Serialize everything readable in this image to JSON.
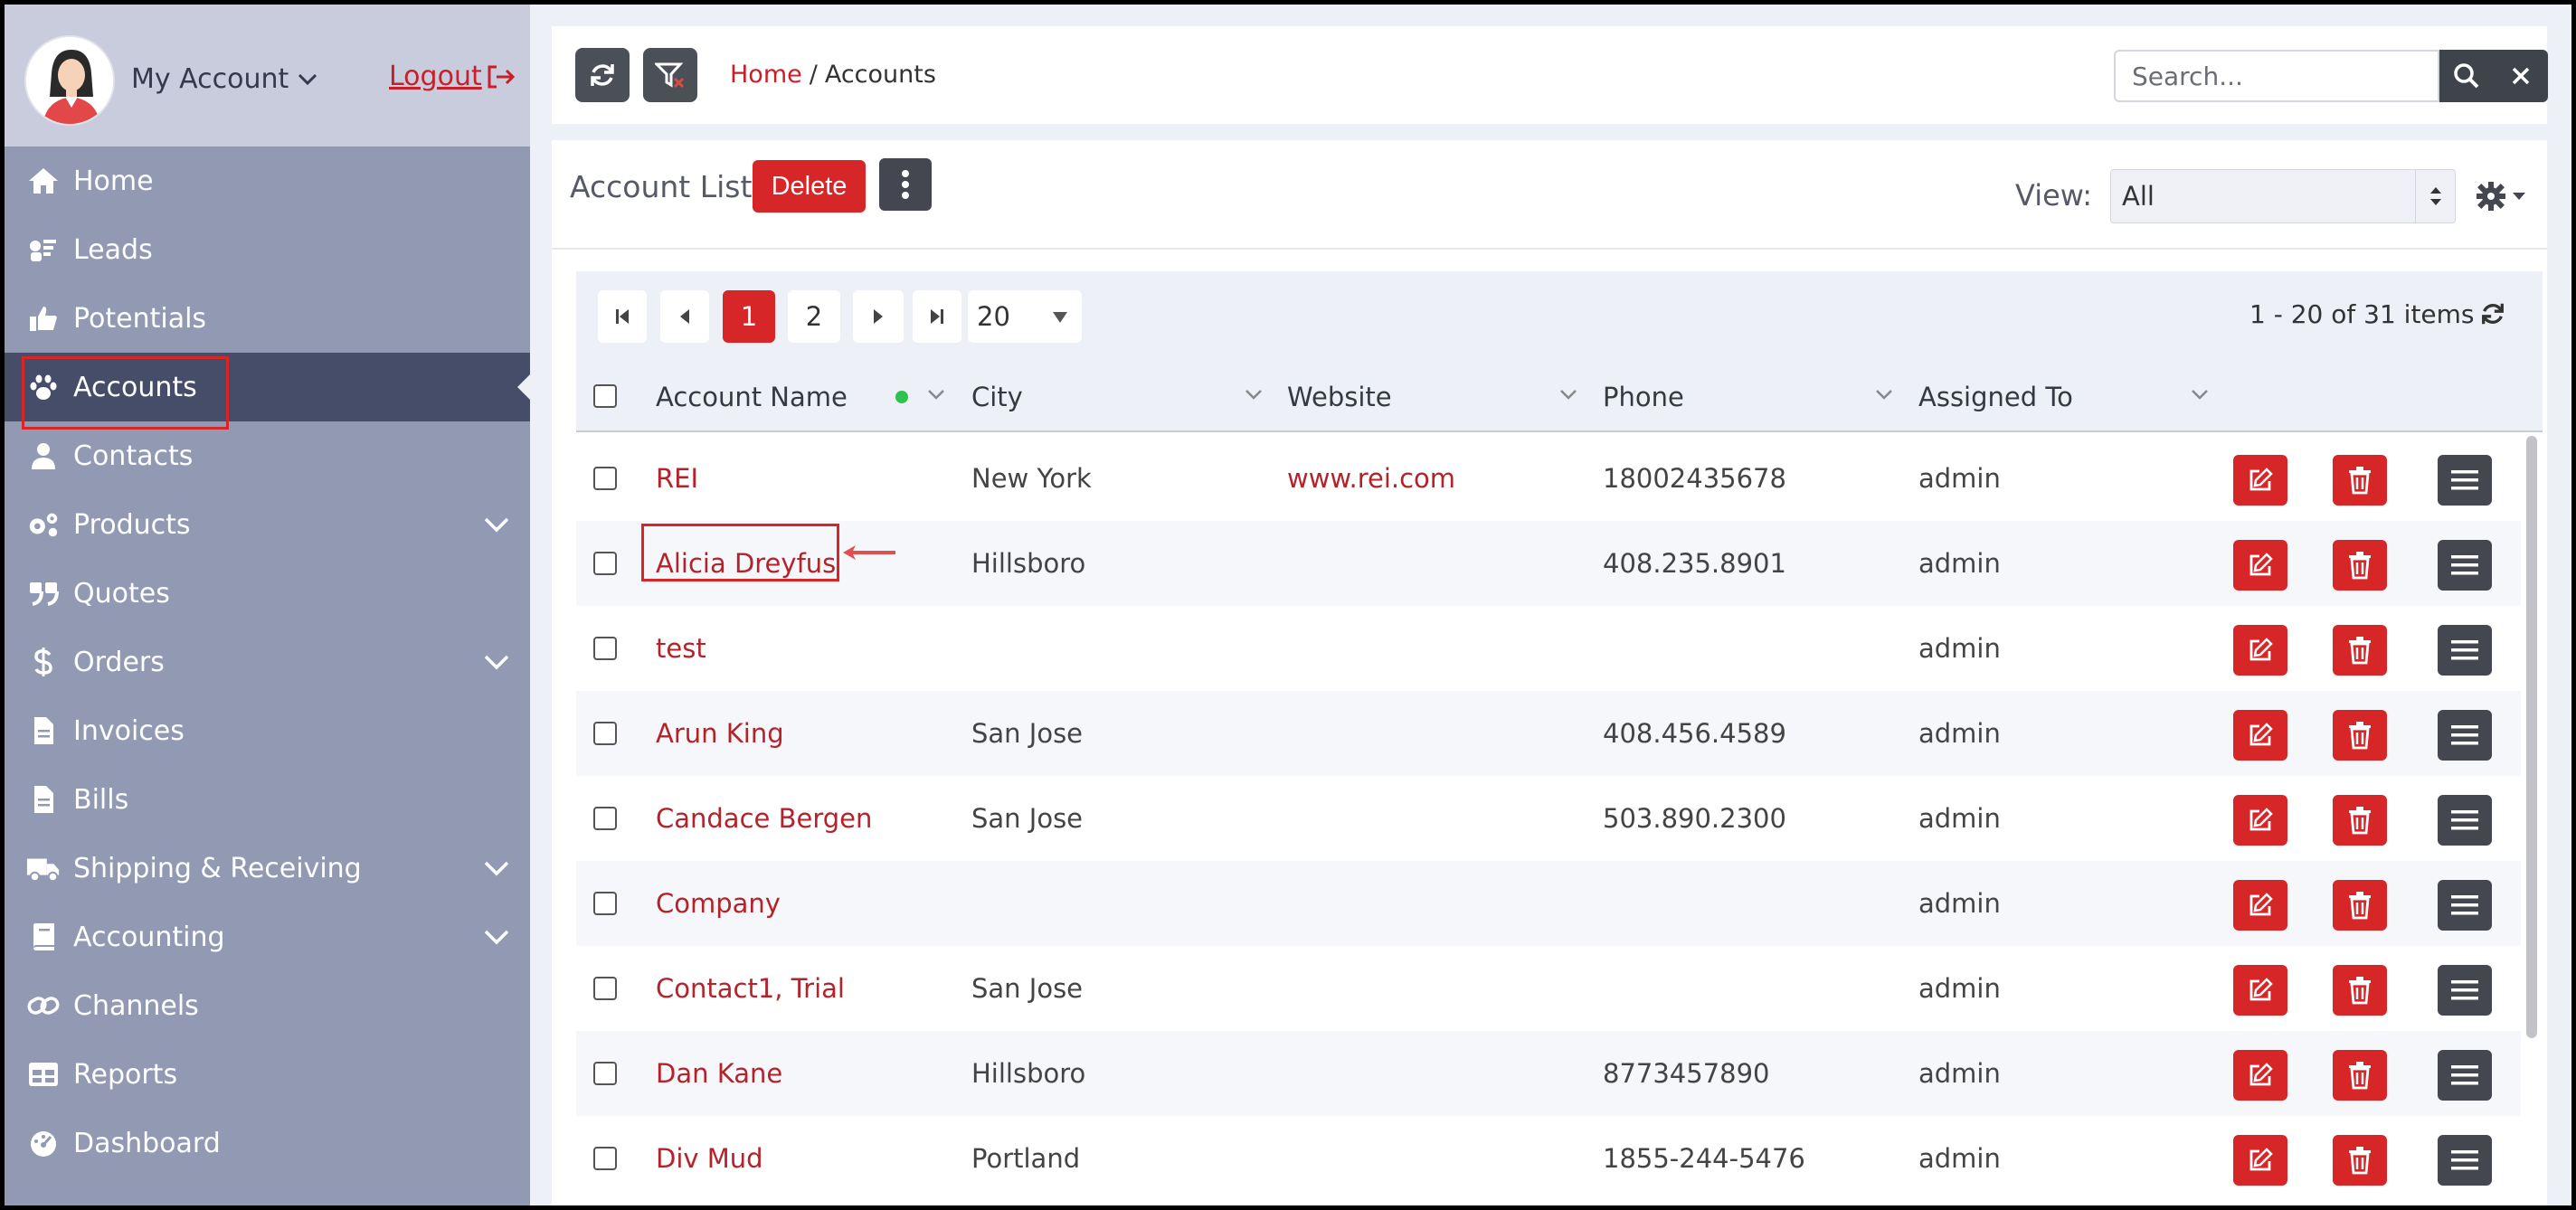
{
  "sidebar": {
    "account_label": "My Account",
    "logout_label": "Logout",
    "items": [
      {
        "label": "Home",
        "icon": "home-icon",
        "expandable": false
      },
      {
        "label": "Leads",
        "icon": "leads-icon",
        "expandable": false
      },
      {
        "label": "Potentials",
        "icon": "thumbs-up-icon",
        "expandable": false
      },
      {
        "label": "Accounts",
        "icon": "paw-icon",
        "expandable": false,
        "active": true
      },
      {
        "label": "Contacts",
        "icon": "user-icon",
        "expandable": false
      },
      {
        "label": "Products",
        "icon": "gears-icon",
        "expandable": true
      },
      {
        "label": "Quotes",
        "icon": "quote-icon",
        "expandable": false
      },
      {
        "label": "Orders",
        "icon": "dollar-icon",
        "expandable": true
      },
      {
        "label": "Invoices",
        "icon": "file-icon",
        "expandable": false
      },
      {
        "label": "Bills",
        "icon": "file-icon",
        "expandable": false
      },
      {
        "label": "Shipping & Receiving",
        "icon": "truck-icon",
        "expandable": true
      },
      {
        "label": "Accounting",
        "icon": "book-icon",
        "expandable": true
      },
      {
        "label": "Channels",
        "icon": "link-icon",
        "expandable": false
      },
      {
        "label": "Reports",
        "icon": "table-icon",
        "expandable": false
      },
      {
        "label": "Dashboard",
        "icon": "gauge-icon",
        "expandable": false
      }
    ]
  },
  "topbar": {
    "breadcrumb_home": "Home",
    "breadcrumb_sep": "/",
    "breadcrumb_current": "Accounts",
    "search_placeholder": "Search..."
  },
  "panel": {
    "title": "Account List",
    "delete_label": "Delete",
    "view_label": "View:",
    "view_value": "All"
  },
  "pager": {
    "pages": [
      "1",
      "2"
    ],
    "current_page": "1",
    "page_size": "20",
    "items_info": "1 - 20 of 31 items"
  },
  "columns": [
    "Account Name",
    "City",
    "Website",
    "Phone",
    "Assigned To"
  ],
  "rows": [
    {
      "name": "REI",
      "city": "New York",
      "website": "www.rei.com",
      "phone": "18002435678",
      "assigned": "admin"
    },
    {
      "name": "Alicia Dreyfus",
      "city": "Hillsboro",
      "website": "",
      "phone": "408.235.8901",
      "assigned": "admin"
    },
    {
      "name": "test",
      "city": "",
      "website": "",
      "phone": "",
      "assigned": "admin"
    },
    {
      "name": "Arun King",
      "city": "San Jose",
      "website": "",
      "phone": "408.456.4589",
      "assigned": "admin"
    },
    {
      "name": "Candace Bergen",
      "city": "San Jose",
      "website": "",
      "phone": "503.890.2300",
      "assigned": "admin"
    },
    {
      "name": "Company",
      "city": "",
      "website": "",
      "phone": "",
      "assigned": "admin"
    },
    {
      "name": "Contact1, Trial",
      "city": "San Jose",
      "website": "",
      "phone": "",
      "assigned": "admin"
    },
    {
      "name": "Dan Kane",
      "city": "Hillsboro",
      "website": "",
      "phone": "8773457890",
      "assigned": "admin"
    },
    {
      "name": "Div Mud",
      "city": "Portland",
      "website": "",
      "phone": "1855-244-5476",
      "assigned": "admin"
    }
  ],
  "colors": {
    "accent_red": "#d62628",
    "link_red": "#b5232a",
    "sidebar_bg": "#9299b3",
    "sidebar_active": "#454d68",
    "dark_button": "#44474f"
  }
}
